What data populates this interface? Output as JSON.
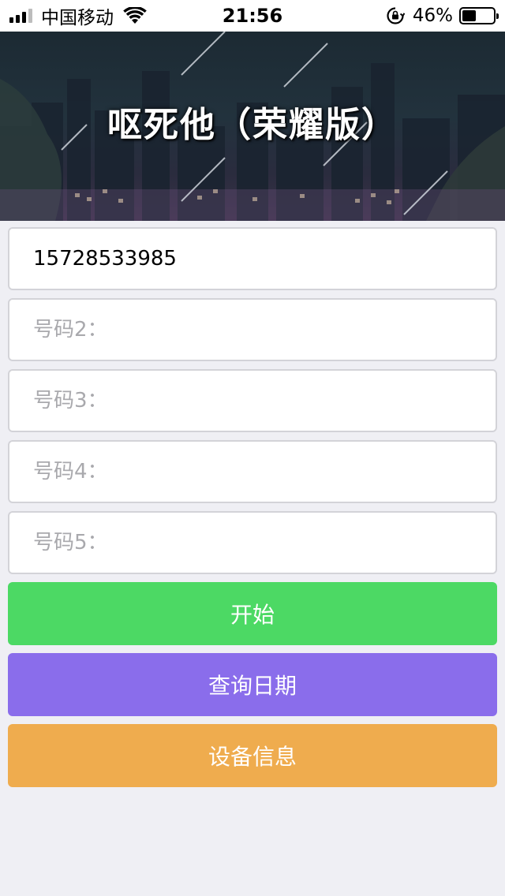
{
  "status_bar": {
    "carrier": "中国移动",
    "time": "21:56",
    "battery_percent": "46%",
    "battery_level": 0.46,
    "signal_bars": 3
  },
  "banner": {
    "title": "呕死他（荣耀版）"
  },
  "form": {
    "phone1": {
      "value": "15728533985",
      "placeholder": ""
    },
    "phone2": {
      "value": "",
      "placeholder": "号码2："
    },
    "phone3": {
      "value": "",
      "placeholder": "号码3："
    },
    "phone4": {
      "value": "",
      "placeholder": "号码4："
    },
    "phone5": {
      "value": "",
      "placeholder": "号码5："
    }
  },
  "buttons": {
    "start": {
      "label": "开始",
      "color": "#4cd964"
    },
    "query_date": {
      "label": "查询日期",
      "color": "#8a6deb"
    },
    "device_info": {
      "label": "设备信息",
      "color": "#efac4e"
    }
  },
  "icons": [
    "signal-icon",
    "wifi-icon",
    "rotation-lock-icon",
    "battery-icon"
  ]
}
